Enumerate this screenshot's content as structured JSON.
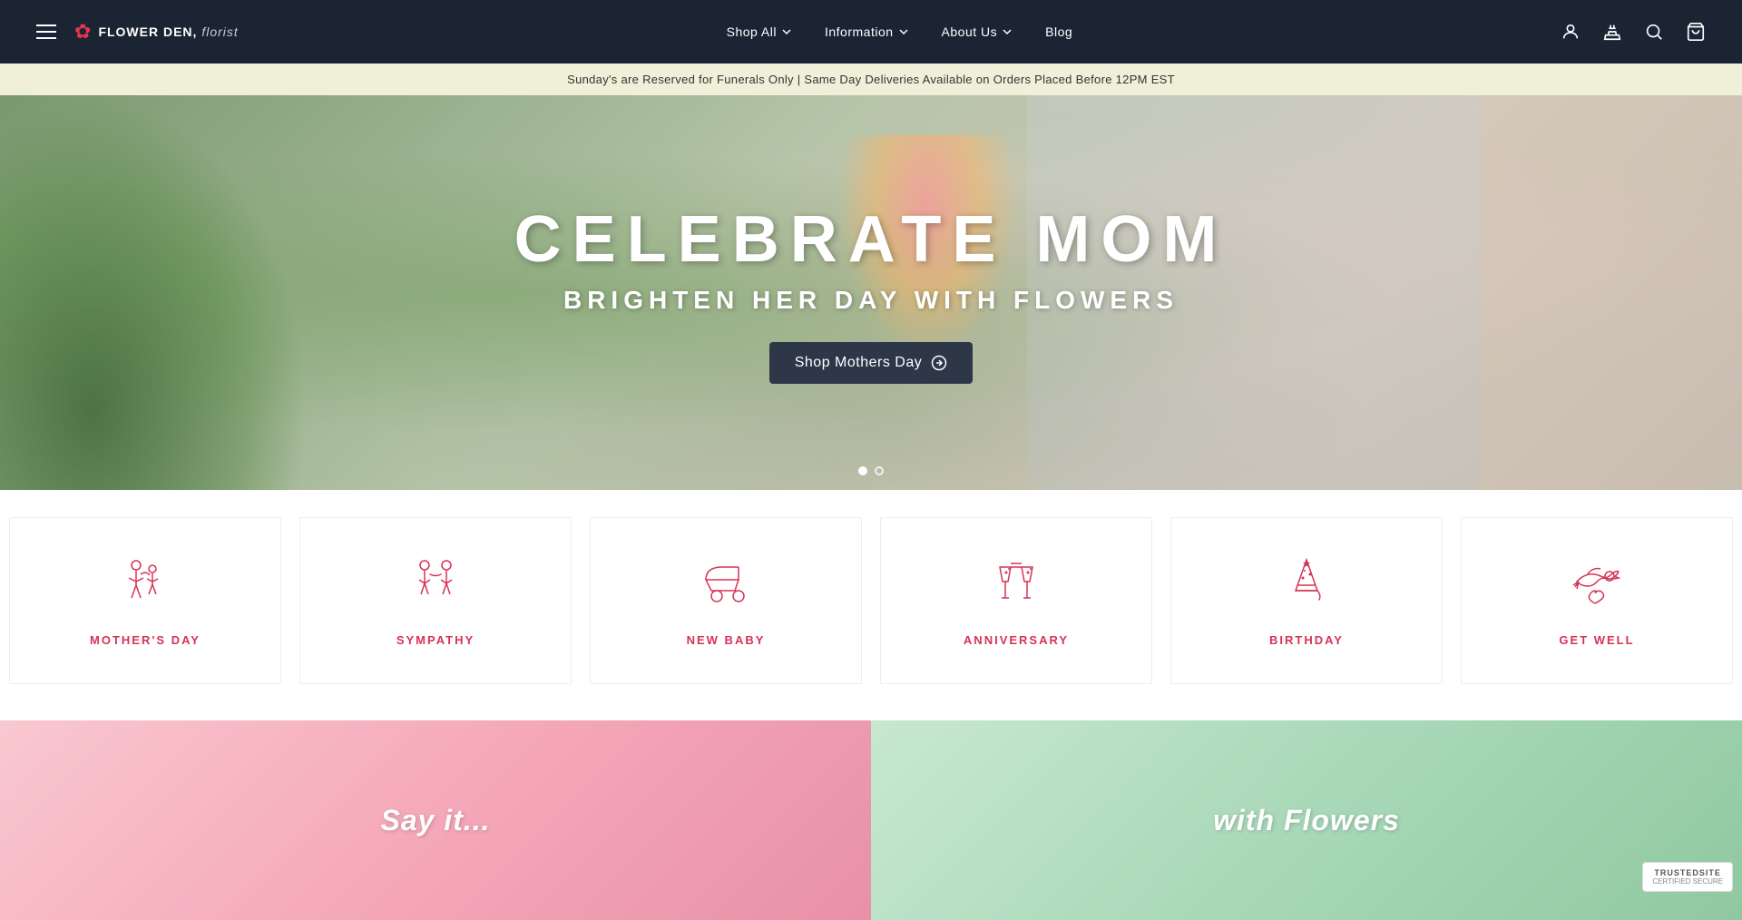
{
  "navbar": {
    "hamburger_label": "Menu",
    "logo": {
      "text_bold": "FLOWER DEN,",
      "text_light": "florist"
    },
    "nav_links": [
      {
        "id": "shop-all",
        "label": "Shop All",
        "has_dropdown": true
      },
      {
        "id": "information",
        "label": "Information",
        "has_dropdown": true
      },
      {
        "id": "about-us",
        "label": "About Us",
        "has_dropdown": true
      },
      {
        "id": "blog",
        "label": "Blog",
        "has_dropdown": false
      }
    ],
    "icons": [
      {
        "id": "account-icon",
        "label": "Account"
      },
      {
        "id": "wishlist-icon",
        "label": "Wishlist"
      },
      {
        "id": "search-icon",
        "label": "Search"
      },
      {
        "id": "cart-icon",
        "label": "Cart"
      }
    ]
  },
  "announcement": {
    "text": "Sunday's are Reserved for Funerals Only | Same Day Deliveries Available on Orders Placed Before 12PM EST"
  },
  "hero": {
    "title": "CELEBRATE MOM",
    "subtitle": "BRIGHTEN HER DAY WITH FLOWERS",
    "cta_label": "Shop Mothers Day",
    "dots": [
      {
        "id": "dot-1",
        "active": true
      },
      {
        "id": "dot-2",
        "active": false
      }
    ]
  },
  "categories": [
    {
      "id": "mothers-day",
      "label": "MOTHER'S DAY",
      "icon": "mothers-day-icon"
    },
    {
      "id": "sympathy",
      "label": "SYMPATHY",
      "icon": "sympathy-icon"
    },
    {
      "id": "new-baby",
      "label": "NEW BABY",
      "icon": "new-baby-icon"
    },
    {
      "id": "anniversary",
      "label": "ANNIVERSARY",
      "icon": "anniversary-icon"
    },
    {
      "id": "birthday",
      "label": "BIRTHDAY",
      "icon": "birthday-icon"
    },
    {
      "id": "get-well",
      "label": "GET WELL",
      "icon": "get-well-icon"
    }
  ],
  "bottom_banners": [
    {
      "id": "banner-say-it",
      "text": "Say it..."
    },
    {
      "id": "banner-flowers",
      "text": "with Flowers"
    }
  ],
  "trusted_site": {
    "label": "TrustedSite",
    "sub": "CERTIFIED SECURE"
  }
}
